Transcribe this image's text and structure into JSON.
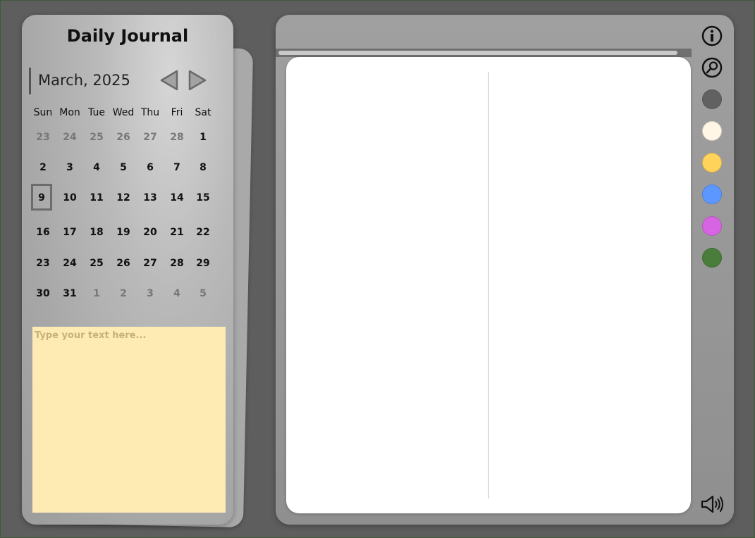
{
  "sidebar": {
    "title": "Daily Journal",
    "month_label": "March, 2025",
    "weekdays": [
      "Sun",
      "Mon",
      "Tue",
      "Wed",
      "Thu",
      "Fri",
      "Sat"
    ],
    "weeks": [
      [
        {
          "d": "23",
          "m": true
        },
        {
          "d": "24",
          "m": true
        },
        {
          "d": "25",
          "m": true
        },
        {
          "d": "26",
          "m": true
        },
        {
          "d": "27",
          "m": true
        },
        {
          "d": "28",
          "m": true
        },
        {
          "d": "1"
        }
      ],
      [
        {
          "d": "2"
        },
        {
          "d": "3"
        },
        {
          "d": "4"
        },
        {
          "d": "5"
        },
        {
          "d": "6"
        },
        {
          "d": "7"
        },
        {
          "d": "8"
        }
      ],
      [
        {
          "d": "9",
          "today": true
        },
        {
          "d": "10"
        },
        {
          "d": "11"
        },
        {
          "d": "12"
        },
        {
          "d": "13"
        },
        {
          "d": "14"
        },
        {
          "d": "15"
        }
      ],
      [
        {
          "d": "16"
        },
        {
          "d": "17"
        },
        {
          "d": "18"
        },
        {
          "d": "19"
        },
        {
          "d": "20"
        },
        {
          "d": "21"
        },
        {
          "d": "22"
        }
      ],
      [
        {
          "d": "23"
        },
        {
          "d": "24"
        },
        {
          "d": "25"
        },
        {
          "d": "26"
        },
        {
          "d": "27"
        },
        {
          "d": "28"
        },
        {
          "d": "29"
        }
      ],
      [
        {
          "d": "30"
        },
        {
          "d": "31"
        },
        {
          "d": "1",
          "m": true
        },
        {
          "d": "2",
          "m": true
        },
        {
          "d": "3",
          "m": true
        },
        {
          "d": "4",
          "m": true
        },
        {
          "d": "5",
          "m": true
        }
      ]
    ],
    "notes_placeholder": "Type your text here...",
    "notes_value": ""
  },
  "toolbar": {
    "icons": [
      "info-icon",
      "search-icon"
    ],
    "colors": [
      {
        "name": "gray",
        "hex": "#616161"
      },
      {
        "name": "cream",
        "hex": "#fff6e6"
      },
      {
        "name": "yellow",
        "hex": "#ffd25a"
      },
      {
        "name": "blue",
        "hex": "#5b97ff"
      },
      {
        "name": "purple",
        "hex": "#d765e3"
      },
      {
        "name": "green",
        "hex": "#4a7c3b"
      }
    ],
    "sound_icon": "speaker-icon"
  }
}
